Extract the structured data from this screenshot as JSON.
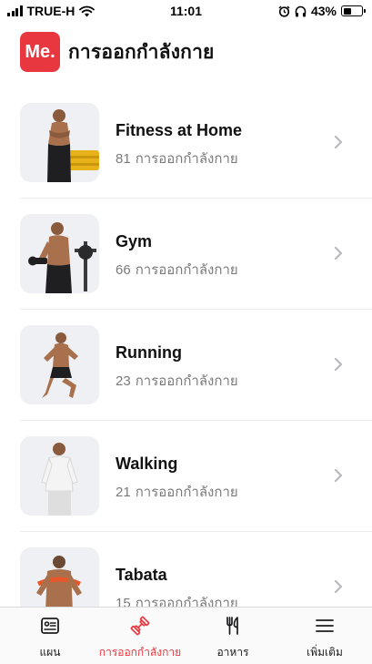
{
  "status_bar": {
    "carrier": "TRUE-H",
    "time": "11:01",
    "battery": "43%",
    "battery_level": 0.43
  },
  "header": {
    "logo_text": "Me.",
    "title": "การออกกำลังกาย"
  },
  "categories": [
    {
      "title": "Fitness at Home",
      "count": "81",
      "unit": "การออกกำลังกาย",
      "icon": "person-on-sofa"
    },
    {
      "title": "Gym",
      "count": "66",
      "unit": "การออกกำลังกาย",
      "icon": "person-lifting-dumbbell"
    },
    {
      "title": "Running",
      "count": "23",
      "unit": "การออกกำลังกาย",
      "icon": "person-running"
    },
    {
      "title": "Walking",
      "count": "21",
      "unit": "การออกกำลังกาย",
      "icon": "person-standing"
    },
    {
      "title": "Tabata",
      "count": "15",
      "unit": "การออกกำลังกาย",
      "icon": "person-with-band"
    }
  ],
  "tabs": [
    {
      "label": "แผน",
      "icon": "plan-icon",
      "active": false
    },
    {
      "label": "การออกกำลังกาย",
      "icon": "dumbbell-icon",
      "active": true
    },
    {
      "label": "อาหาร",
      "icon": "fork-knife-icon",
      "active": false
    },
    {
      "label": "เพิ่มเติม",
      "icon": "menu-icon",
      "active": false
    }
  ],
  "colors": {
    "brand": "#e8373f",
    "thumb_bg": "#eef0f3",
    "secondary_text": "#7a7a7a"
  }
}
